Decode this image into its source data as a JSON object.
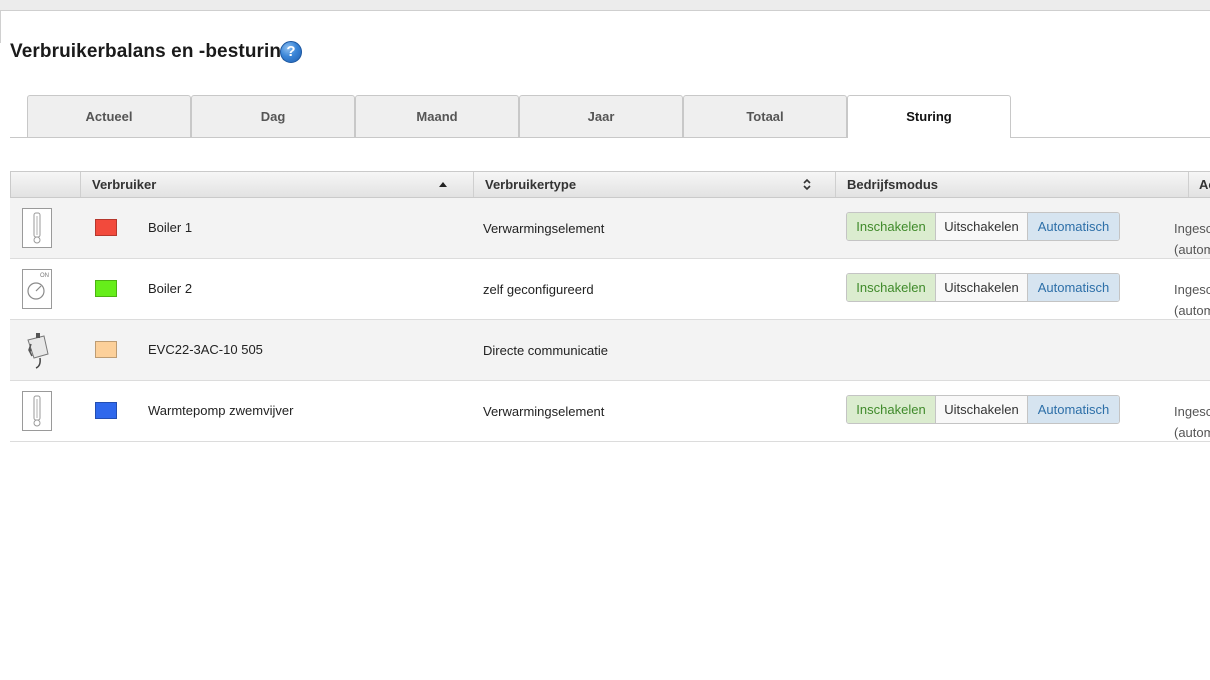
{
  "page": {
    "title": "Verbruikerbalans en -besturing",
    "help_icon": "question-circle-icon"
  },
  "tabs": [
    {
      "label": "Actueel",
      "active": false
    },
    {
      "label": "Dag",
      "active": false
    },
    {
      "label": "Maand",
      "active": false
    },
    {
      "label": "Jaar",
      "active": false
    },
    {
      "label": "Totaal",
      "active": false
    },
    {
      "label": "Sturing",
      "active": true
    }
  ],
  "table": {
    "columns": {
      "consumer": "Verbruiker",
      "type": "Verbruikertype",
      "mode": "Bedrijfsmodus",
      "action_partial": "Ac"
    },
    "sort": {
      "consumer": "ascending"
    },
    "rows": [
      {
        "icon": "heating-element-icon",
        "color": "#f24a3c",
        "name": "Boiler 1",
        "type": "Verwarmingselement",
        "buttons": {
          "on": "Inschakelen",
          "off": "Uitschakelen",
          "auto": "Automatisch"
        },
        "status_line1": "Ingesc",
        "status_line2": "(autom"
      },
      {
        "icon": "on-switch-icon",
        "color": "#66ee1a",
        "name": "Boiler 2",
        "type": "zelf geconfigureerd",
        "buttons": {
          "on": "Inschakelen",
          "off": "Uitschakelen",
          "auto": "Automatisch"
        },
        "status_line1": "Ingesc",
        "status_line2": "(autom"
      },
      {
        "icon": "charger-plug-icon",
        "color": "#fcd09a",
        "name": "EVC22-3AC-10 505",
        "type": "Directe communicatie"
      },
      {
        "icon": "heating-element-icon",
        "color": "#2f68ec",
        "name": "Warmtepomp zwemvijver",
        "type": "Verwarmingselement",
        "buttons": {
          "on": "Inschakelen",
          "off": "Uitschakelen",
          "auto": "Automatisch"
        },
        "status_line1": "Ingesc",
        "status_line2": "(autom"
      }
    ]
  }
}
